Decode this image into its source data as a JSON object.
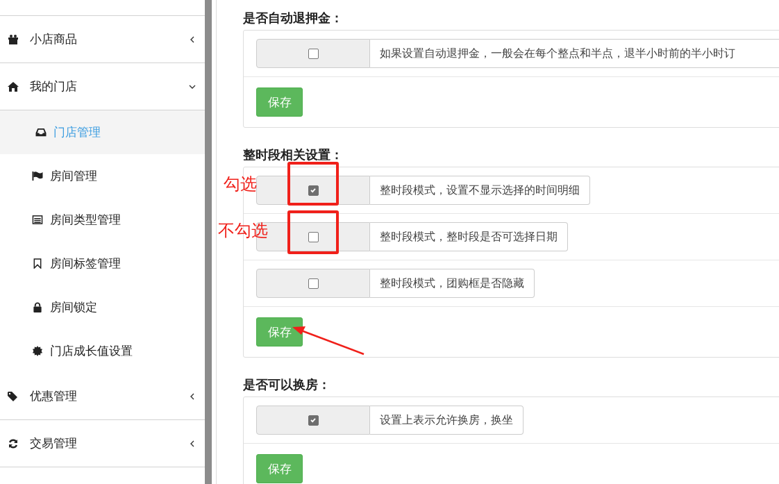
{
  "sidebar": {
    "items": [
      {
        "label": "小店商品",
        "expanded": false
      },
      {
        "label": "我的门店",
        "expanded": true,
        "children": [
          {
            "label": "门店管理",
            "selected": true
          },
          {
            "label": "房间管理",
            "selected": false
          },
          {
            "label": "房间类型管理",
            "selected": false
          },
          {
            "label": "房间标签管理",
            "selected": false
          },
          {
            "label": "房间锁定",
            "selected": false
          },
          {
            "label": "门店成长值设置",
            "selected": false
          }
        ]
      },
      {
        "label": "优惠管理",
        "expanded": false
      },
      {
        "label": "交易管理",
        "expanded": false
      }
    ]
  },
  "sections": [
    {
      "title": "是否自动退押金：",
      "options": [
        {
          "checked": false,
          "text": "如果设置自动退押金，一般会在每个整点和半点，退半小时前的半小时订"
        }
      ],
      "button": "保存"
    },
    {
      "title": "整时段相关设置：",
      "options": [
        {
          "checked": true,
          "text": "整时段模式，设置不显示选择的时间明细"
        },
        {
          "checked": false,
          "text": "整时段模式，整时段是否可选择日期"
        },
        {
          "checked": false,
          "text": "整时段模式，团购框是否隐藏"
        }
      ],
      "button": "保存"
    },
    {
      "title": "是否可以换房：",
      "options": [
        {
          "checked": true,
          "text": "设置上表示允许换房，换坐"
        }
      ],
      "button": "保存"
    }
  ],
  "annotations": [
    {
      "label": "勾选"
    },
    {
      "label": "不勾选"
    }
  ]
}
